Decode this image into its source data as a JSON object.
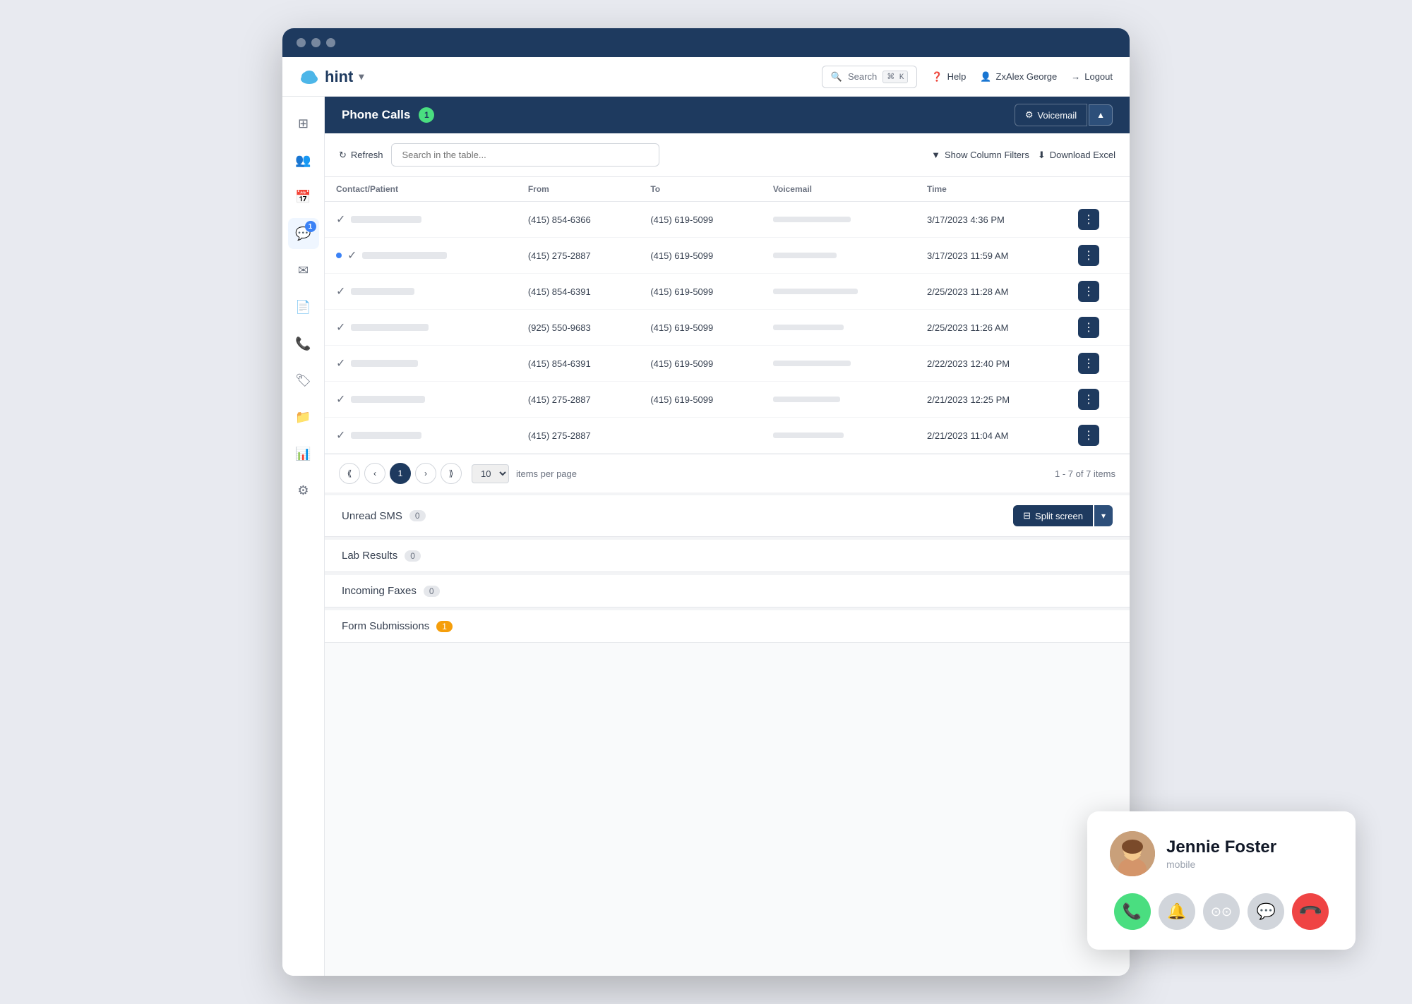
{
  "browser": {
    "dots": [
      "dot1",
      "dot2",
      "dot3"
    ]
  },
  "topnav": {
    "logo_text": "hint",
    "logo_dropdown": "▾",
    "search_label": "Search",
    "search_shortcut": "⌘ K",
    "help_label": "Help",
    "user_label": "ZxAlex George",
    "logout_label": "Logout"
  },
  "sidebar": {
    "items": [
      {
        "id": "dashboard",
        "icon": "⊞",
        "label": "Dashboard",
        "active": false,
        "badge": null
      },
      {
        "id": "patients",
        "icon": "👥",
        "label": "Patients",
        "active": false,
        "badge": null
      },
      {
        "id": "calendar",
        "icon": "📅",
        "label": "Calendar",
        "active": false,
        "badge": null
      },
      {
        "id": "messages",
        "icon": "💬",
        "label": "Messages",
        "active": true,
        "badge": "1"
      },
      {
        "id": "email",
        "icon": "✉",
        "label": "Email",
        "active": false,
        "badge": null
      },
      {
        "id": "documents",
        "icon": "📄",
        "label": "Documents",
        "active": false,
        "badge": null
      },
      {
        "id": "phone",
        "icon": "📞",
        "label": "Phone",
        "active": false,
        "badge": null
      },
      {
        "id": "tags",
        "icon": "🏷",
        "label": "Tags",
        "active": false,
        "badge": null
      },
      {
        "id": "folders",
        "icon": "📁",
        "label": "Folders",
        "active": false,
        "badge": null
      },
      {
        "id": "analytics",
        "icon": "📊",
        "label": "Analytics",
        "active": false,
        "badge": null
      },
      {
        "id": "settings",
        "icon": "⚙",
        "label": "Settings",
        "active": false,
        "badge": null
      }
    ]
  },
  "phone_calls": {
    "title": "Phone Calls",
    "badge": "1",
    "voicemail_btn": "Voicemail",
    "refresh_btn": "Refresh",
    "search_placeholder": "Search in the table...",
    "filter_btn": "Show Column Filters",
    "download_btn": "Download Excel",
    "columns": [
      "Contact/Patient",
      "From",
      "To",
      "Voicemail",
      "Time"
    ],
    "rows": [
      {
        "id": 1,
        "from": "(415) 854-6366",
        "to": "(415) 619-5099",
        "time": "3/17/2023 4:36 PM",
        "unread": false,
        "voicemail_width": 110
      },
      {
        "id": 2,
        "from": "(415) 275-2887",
        "to": "(415) 619-5099",
        "time": "3/17/2023 11:59 AM",
        "unread": true,
        "voicemail_width": 90
      },
      {
        "id": 3,
        "from": "(415) 854-6391",
        "to": "(415) 619-5099",
        "time": "2/25/2023 11:28 AM",
        "unread": false,
        "voicemail_width": 120
      },
      {
        "id": 4,
        "from": "(925) 550-9683",
        "to": "(415) 619-5099",
        "time": "2/25/2023 11:26 AM",
        "unread": false,
        "voicemail_width": 100
      },
      {
        "id": 5,
        "from": "(415) 854-6391",
        "to": "(415) 619-5099",
        "time": "2/22/2023 12:40 PM",
        "unread": false,
        "voicemail_width": 110
      },
      {
        "id": 6,
        "from": "(415) 275-2887",
        "to": "(415) 619-5099",
        "time": "2/21/2023 12:25 PM",
        "unread": false,
        "voicemail_width": 95
      },
      {
        "id": 7,
        "from": "(415) 275-2887",
        "to": "",
        "time": "2/21/2023 11:04 AM",
        "unread": false,
        "voicemail_width": 100
      }
    ],
    "pagination": {
      "current_page": 1,
      "per_page": 10,
      "items_label": "items per page",
      "summary": "1 - 7 of 7 items"
    }
  },
  "unread_sms": {
    "title": "Unread SMS",
    "count": "0",
    "split_screen_btn": "Split screen"
  },
  "lab_results": {
    "title": "Lab Results",
    "count": "0"
  },
  "incoming_faxes": {
    "title": "Incoming Faxes",
    "count": "0"
  },
  "form_submissions": {
    "title": "Form Submissions",
    "count": "1"
  },
  "incoming_call": {
    "caller_name": "Jennie Foster",
    "caller_type": "mobile",
    "btn_accept_icon": "📞",
    "btn_silent_icon": "🔔",
    "btn_voicemail_icon": "📻",
    "btn_message_icon": "💬",
    "btn_decline_icon": "📞"
  }
}
